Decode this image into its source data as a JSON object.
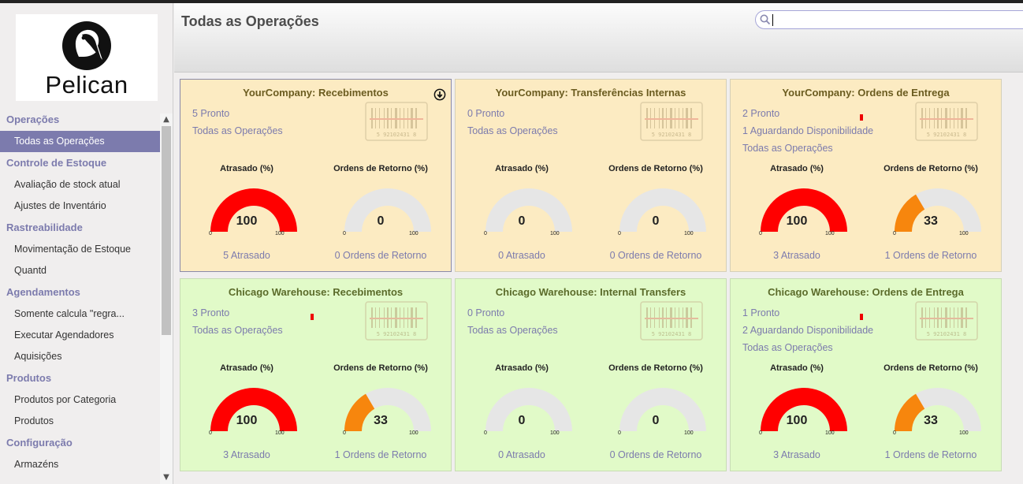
{
  "app": {
    "logo_text": "Pelican"
  },
  "page": {
    "title": "Todas as Operações"
  },
  "search": {
    "value": "",
    "placeholder": ""
  },
  "sidebar": {
    "scroll_up": "▲",
    "scroll_down": "▼",
    "menu": [
      {
        "type": "section",
        "label": "Operações"
      },
      {
        "type": "item",
        "label": "Todas as Operações",
        "active": true
      },
      {
        "type": "section",
        "label": "Controle de Estoque"
      },
      {
        "type": "item",
        "label": "Avaliação de stock atual"
      },
      {
        "type": "item",
        "label": "Ajustes de Inventário"
      },
      {
        "type": "section",
        "label": "Rastreabilidade"
      },
      {
        "type": "item",
        "label": "Movimentação de Estoque"
      },
      {
        "type": "item",
        "label": "Quantd"
      },
      {
        "type": "section",
        "label": "Agendamentos"
      },
      {
        "type": "item",
        "label": "Somente calcula \"regra..."
      },
      {
        "type": "item",
        "label": "Executar Agendadores"
      },
      {
        "type": "item",
        "label": "Aquisições"
      },
      {
        "type": "section",
        "label": "Produtos"
      },
      {
        "type": "item",
        "label": "Produtos por Categoria"
      },
      {
        "type": "item",
        "label": "Produtos"
      },
      {
        "type": "section",
        "label": "Configuração"
      },
      {
        "type": "item",
        "label": "Armazéns"
      }
    ]
  },
  "colors": {
    "accent": "#7c7bad",
    "card_yellow": "#fcebc2",
    "card_green": "#e1fac8",
    "gauge_late": "#ff0000",
    "gauge_return": "#f7860d",
    "gauge_track": "#e6e6e6",
    "marker": "#ee0000"
  },
  "gauge_labels": {
    "late": "Atrasado (%)",
    "returns": "Ordens de Retorno (%)",
    "min": "0",
    "max": "100"
  },
  "barcode_text": "5 92102431 8",
  "cards": [
    {
      "title": "YourCompany: Recebimentos",
      "color": "yellow",
      "selected": true,
      "download_icon": true,
      "marker": false,
      "links": [
        "5 Pronto",
        "Todas as Operações"
      ],
      "late_pct": 100,
      "late_text": "100",
      "late_footer": "5 Atrasado",
      "return_pct": 0,
      "return_text": "0",
      "return_footer": "0 Ordens de Retorno"
    },
    {
      "title": "YourCompany: Transferências Internas",
      "color": "yellow",
      "selected": false,
      "download_icon": false,
      "marker": false,
      "links": [
        "0 Pronto",
        "Todas as Operações"
      ],
      "late_pct": 0,
      "late_text": "0",
      "late_footer": "0 Atrasado",
      "return_pct": 0,
      "return_text": "0",
      "return_footer": "0 Ordens de Retorno"
    },
    {
      "title": "YourCompany: Ordens de Entrega",
      "color": "yellow",
      "selected": false,
      "download_icon": false,
      "marker": true,
      "links": [
        "2 Pronto",
        "1 Aguardando Disponibilidade",
        "Todas as Operações"
      ],
      "late_pct": 100,
      "late_text": "100",
      "late_footer": "3 Atrasado",
      "return_pct": 33,
      "return_text": "33",
      "return_footer": "1 Ordens de Retorno"
    },
    {
      "title": "Chicago Warehouse: Recebimentos",
      "color": "green",
      "selected": false,
      "download_icon": false,
      "marker": true,
      "links": [
        "3 Pronto",
        "Todas as Operações"
      ],
      "late_pct": 100,
      "late_text": "100",
      "late_footer": "3 Atrasado",
      "return_pct": 33,
      "return_text": "33",
      "return_footer": "1 Ordens de Retorno"
    },
    {
      "title": "Chicago Warehouse: Internal Transfers",
      "color": "green",
      "selected": false,
      "download_icon": false,
      "marker": false,
      "links": [
        "0 Pronto",
        "Todas as Operações"
      ],
      "late_pct": 0,
      "late_text": "0",
      "late_footer": "0 Atrasado",
      "return_pct": 0,
      "return_text": "0",
      "return_footer": "0 Ordens de Retorno"
    },
    {
      "title": "Chicago Warehouse: Ordens de Entrega",
      "color": "green",
      "selected": false,
      "download_icon": false,
      "marker": true,
      "links": [
        "1 Pronto",
        "2 Aguardando Disponibilidade",
        "Todas as Operações"
      ],
      "late_pct": 100,
      "late_text": "100",
      "late_footer": "3 Atrasado",
      "return_pct": 33,
      "return_text": "33",
      "return_footer": "1 Ordens de Retorno"
    }
  ]
}
